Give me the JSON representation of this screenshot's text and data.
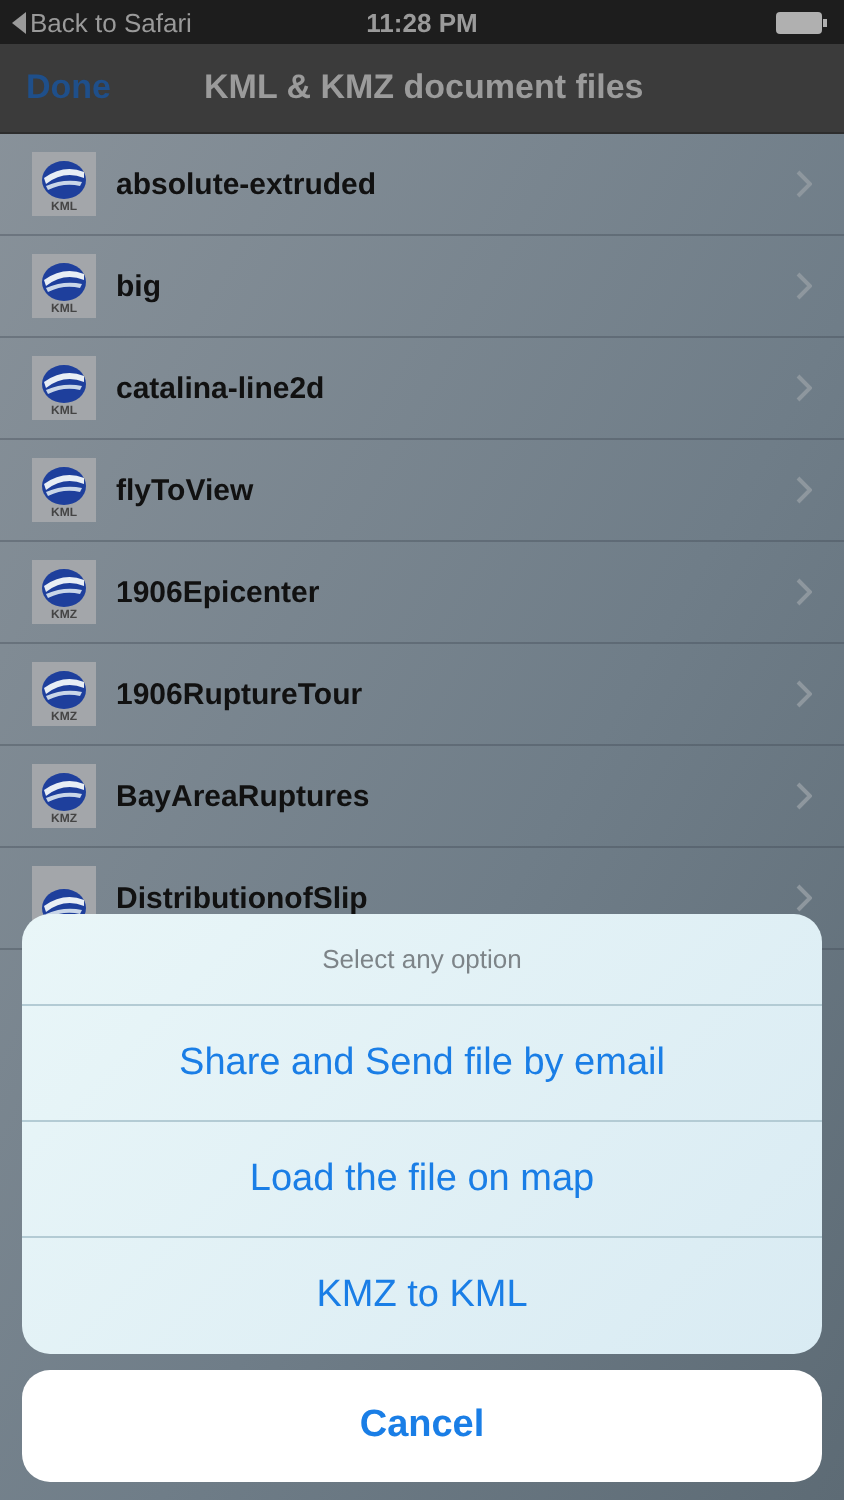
{
  "status_bar": {
    "back": "Back to Safari",
    "time": "11:28 PM"
  },
  "nav": {
    "done": "Done",
    "title": "KML & KMZ document files"
  },
  "files": [
    {
      "name": "absolute-extruded",
      "badge": "KML"
    },
    {
      "name": "big",
      "badge": "KML"
    },
    {
      "name": "catalina-line2d",
      "badge": "KML"
    },
    {
      "name": "flyToView",
      "badge": "KML"
    },
    {
      "name": "1906Epicenter",
      "badge": "KMZ"
    },
    {
      "name": "1906RuptureTour",
      "badge": "KMZ"
    },
    {
      "name": "BayAreaRuptures",
      "badge": "KMZ"
    },
    {
      "name": "DistributionofSlip"
    }
  ],
  "action_sheet": {
    "title": "Select any option",
    "options": [
      "Share and Send file by email",
      "Load the file on map",
      "KMZ to KML"
    ],
    "cancel": "Cancel"
  }
}
